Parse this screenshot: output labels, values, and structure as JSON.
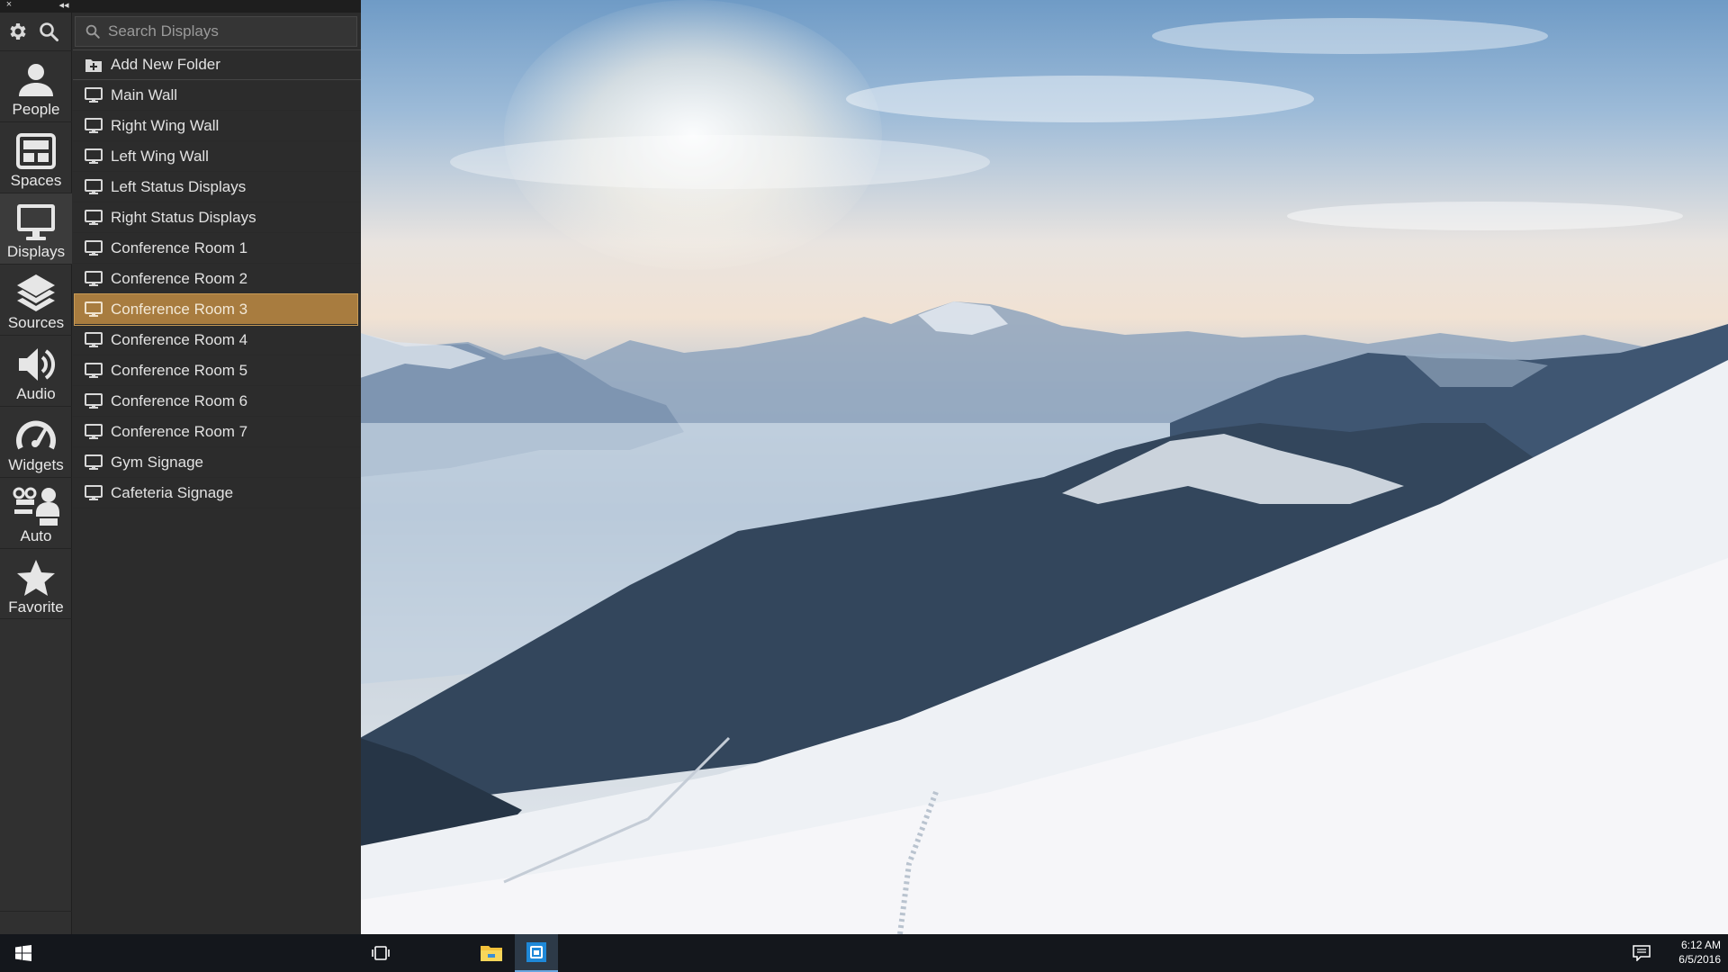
{
  "titlebar": {
    "close_glyph": "×",
    "collapse_glyph": "◂◂"
  },
  "rail": {
    "tools": [
      {
        "name": "gear-icon"
      },
      {
        "name": "search-icon"
      }
    ],
    "items": [
      {
        "label": "People",
        "icon": "person-icon"
      },
      {
        "label": "Spaces",
        "icon": "spaces-icon"
      },
      {
        "label": "Displays",
        "icon": "monitor-icon"
      },
      {
        "label": "Sources",
        "icon": "layers-icon"
      },
      {
        "label": "Audio",
        "icon": "speaker-icon"
      },
      {
        "label": "Widgets",
        "icon": "gauge-icon"
      },
      {
        "label": "Auto",
        "icon": "automation-icon"
      },
      {
        "label": "Favorite",
        "icon": "star-icon"
      }
    ],
    "active": "Displays"
  },
  "search": {
    "placeholder": "Search Displays",
    "value": ""
  },
  "displays": {
    "add_folder_label": "Add New Folder",
    "items": [
      "Main Wall",
      "Right Wing Wall",
      "Left Wing Wall",
      "Left Status Displays",
      "Right Status Displays",
      "Conference Room 1",
      "Conference Room 2",
      "Conference Room 3",
      "Conference Room 4",
      "Conference Room 5",
      "Conference Room 6",
      "Conference Room 7",
      "Gym Signage",
      "Cafeteria Signage"
    ],
    "selected": "Conference Room 3"
  },
  "colors": {
    "selected_bg": "#a87c3f",
    "panel_bg": "#2c2c2c",
    "taskbar_bg": "#14171c"
  },
  "taskbar": {
    "icons": [
      "windows-start-icon",
      "task-view-icon",
      "file-explorer-icon",
      "store-app-icon",
      "notifications-icon"
    ],
    "time": "6:12 AM",
    "date": "6/5/2016"
  }
}
